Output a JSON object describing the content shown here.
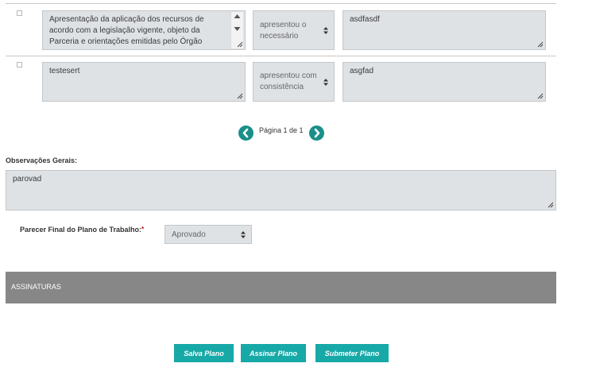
{
  "rows": [
    {
      "description": "Apresentação da aplicação dos recursos de acordo com a legislação vigente, objeto da Parceria e orientações emitidas pelo Órgão Gestor da",
      "status": "apresentou o necessário",
      "note": "asdfasdf"
    },
    {
      "description": "testesert",
      "status": "apresentou com consistência",
      "note": "asgfad"
    }
  ],
  "pagination": {
    "label": "Página 1 de 1"
  },
  "general_notes": {
    "label": "Observações Gerais:",
    "value": "parovad"
  },
  "final_opinion": {
    "label": "Parecer Final do Plano de Trabalho:",
    "required_mark": "*",
    "selected": "Aprovado"
  },
  "signatures": {
    "title": "ASSINATURAS"
  },
  "actions": {
    "save": "Salva Plano",
    "sign": "Assinar Plano",
    "submit": "Submeter Plano"
  },
  "colors": {
    "accent": "#17a9a8",
    "nav_button": "#1a8f8a",
    "section_bar": "#878787",
    "required": "#cc0000"
  },
  "icons": {
    "prev": "chevron-left-icon",
    "next": "chevron-right-icon",
    "resize": "resize-grip-icon",
    "select": "select-arrows-icon"
  }
}
